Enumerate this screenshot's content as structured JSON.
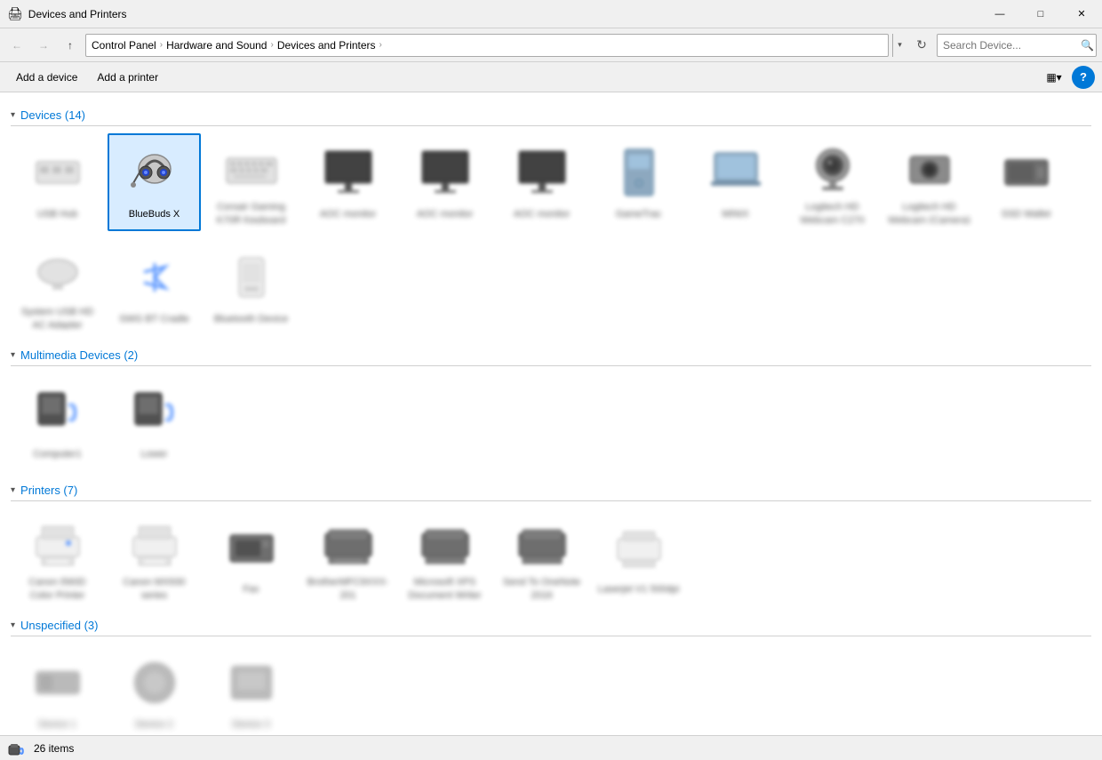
{
  "window": {
    "title": "Devices and Printers",
    "icon": "🖨"
  },
  "titlebar": {
    "controls": {
      "minimize": "—",
      "maximize": "□",
      "close": "✕"
    }
  },
  "addressbar": {
    "breadcrumbs": [
      {
        "label": "Control Panel",
        "sep": "›"
      },
      {
        "label": "Hardware and Sound",
        "sep": "›"
      },
      {
        "label": "Devices and Printers",
        "sep": "›"
      }
    ],
    "search_placeholder": "Search Device...",
    "search_icon": "🔍"
  },
  "toolbar": {
    "add_device": "Add a device",
    "add_printer": "Add a printer",
    "view_icon": "▦",
    "view_dropdown": "▾",
    "help": "?"
  },
  "sections": {
    "devices": {
      "title": "Devices",
      "count": 14,
      "items": [
        {
          "name": "USB Hub",
          "blurred": true
        },
        {
          "name": "BlueBuds X",
          "blurred": false,
          "selected": true
        },
        {
          "name": "Corsair Gaming K70R Keyboard",
          "blurred": true
        },
        {
          "name": "AOC monitor",
          "blurred": true
        },
        {
          "name": "AOC monitor",
          "blurred": true
        },
        {
          "name": "AOC monitor",
          "blurred": true
        },
        {
          "name": "GameTrac",
          "blurred": true
        },
        {
          "name": "MINIX",
          "blurred": true
        },
        {
          "name": "Logitech HD Webcam C270",
          "blurred": true
        },
        {
          "name": "Logitech HD Webcam (Camera)",
          "blurred": true
        },
        {
          "name": "SSD Wallet",
          "blurred": true
        },
        {
          "name": "System USB HD AC Adapter",
          "blurred": true
        },
        {
          "name": "SWG BT Cradle",
          "blurred": true
        },
        {
          "name": "Bluetooth Device",
          "blurred": true
        }
      ]
    },
    "multimedia": {
      "title": "Multimedia Devices",
      "count": 2,
      "items": [
        {
          "name": "Computer1",
          "blurred": true
        },
        {
          "name": "Lower",
          "blurred": true
        }
      ]
    },
    "printers": {
      "title": "Printers",
      "count": 7,
      "items": [
        {
          "name": "Canon i560D Color Printer",
          "blurred": true
        },
        {
          "name": "Canon MX930 series",
          "blurred": true
        },
        {
          "name": "Fax",
          "blurred": true
        },
        {
          "name": "BrotherMFC9XXX-201",
          "blurred": true
        },
        {
          "name": "Microsoft XPS Document Writer",
          "blurred": true
        },
        {
          "name": "Send To OneNote 2016",
          "blurred": true
        },
        {
          "name": "Laserjet V1 500dpi",
          "blurred": true
        }
      ]
    },
    "unspecified": {
      "title": "Unspecified",
      "count": 3,
      "items": [
        {
          "name": "Device 1",
          "blurred": true
        },
        {
          "name": "Device 2",
          "blurred": true
        },
        {
          "name": "Device 3",
          "blurred": true
        }
      ]
    }
  },
  "statusbar": {
    "count": "26 items"
  }
}
